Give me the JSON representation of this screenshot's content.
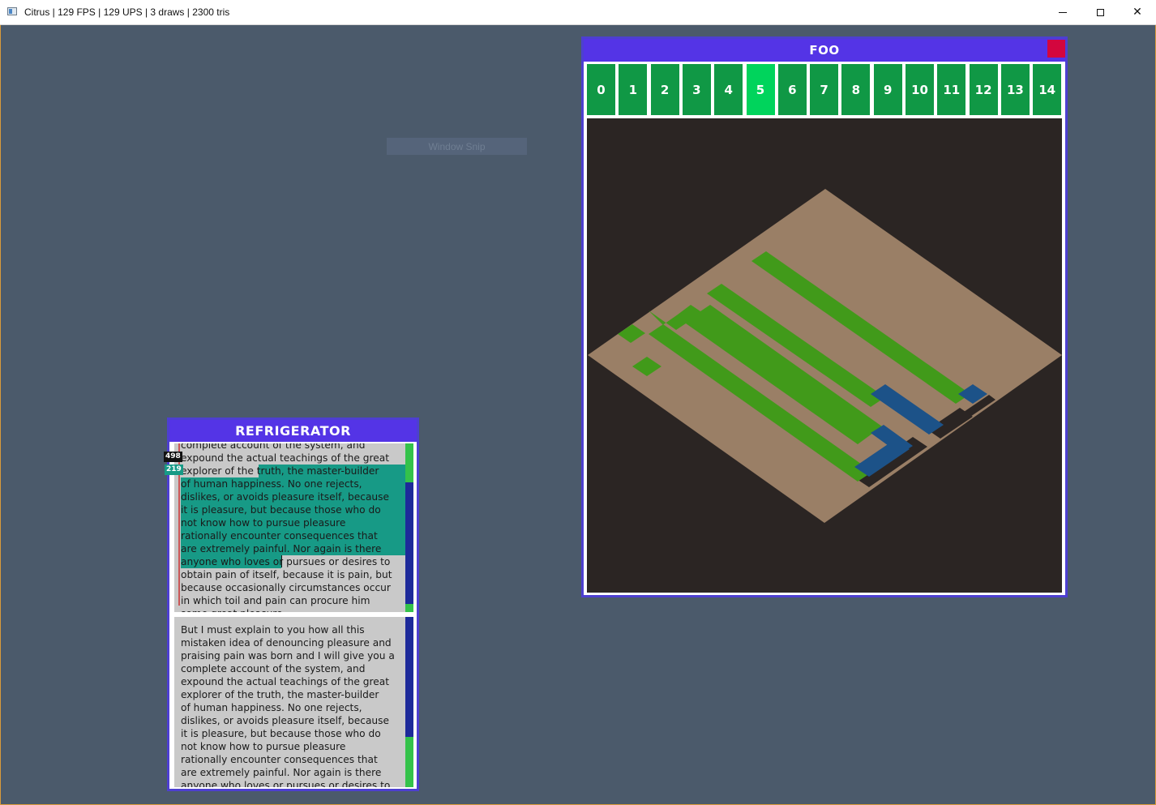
{
  "os_window": {
    "title": "Citrus | 129 FPS | 129 UPS | 3 draws | 2300 tris",
    "controls": {
      "minimize_icon": "minimize-icon",
      "maximize_icon": "maximize-icon",
      "close_glyph": "✕"
    }
  },
  "snip_label": "Window Snip",
  "foo_panel": {
    "title": "FOO",
    "close_color": "#d3063e",
    "tabs": [
      "0",
      "1",
      "2",
      "3",
      "4",
      "5",
      "6",
      "7",
      "8",
      "9",
      "10",
      "11",
      "12",
      "13",
      "14"
    ],
    "active_tab": "5",
    "tab_color": "#109845",
    "active_tab_color": "#00d45c",
    "map_colors": {
      "background": "#2b2523",
      "ground": "#9a7f66",
      "grass": "#419a1a",
      "water": "#1c5288"
    }
  },
  "refrigerator_panel": {
    "title": "REFRIGERATOR",
    "line_badge_total": "498",
    "line_badge_current": "219",
    "selection_color": "#179a86",
    "editor_top": {
      "lines": [
        "complete account of the system, and",
        "expound the actual teachings of the great",
        "explorer of the truth, the master-builder",
        "of human happiness. No one rejects,",
        "dislikes, or avoids pleasure itself, because",
        "it is pleasure, but because those who do",
        "not know how to pursue pleasure",
        "rationally encounter consequences that",
        "are extremely painful. Nor again is there",
        "anyone who loves or pursues or desires to",
        "obtain pain of itself, because it is pain, but",
        "because occasionally circumstances occur",
        "in which toil and pain can procure him",
        "some great pleasure."
      ]
    },
    "editor_bottom": {
      "lines": [
        "But I must explain to you how all this",
        "mistaken idea of denouncing pleasure and",
        "praising pain was born and I will give you a",
        "complete account of the system, and",
        "expound the actual teachings of the great",
        "explorer of the truth, the master-builder",
        "of human happiness. No one rejects,",
        "dislikes, or avoids pleasure itself, because",
        "it is pleasure, but because those who do",
        "not know how to pursue pleasure",
        "rationally encounter consequences that",
        "are extremely painful. Nor again is there",
        "anyone who loves or pursues or desires to"
      ]
    }
  }
}
